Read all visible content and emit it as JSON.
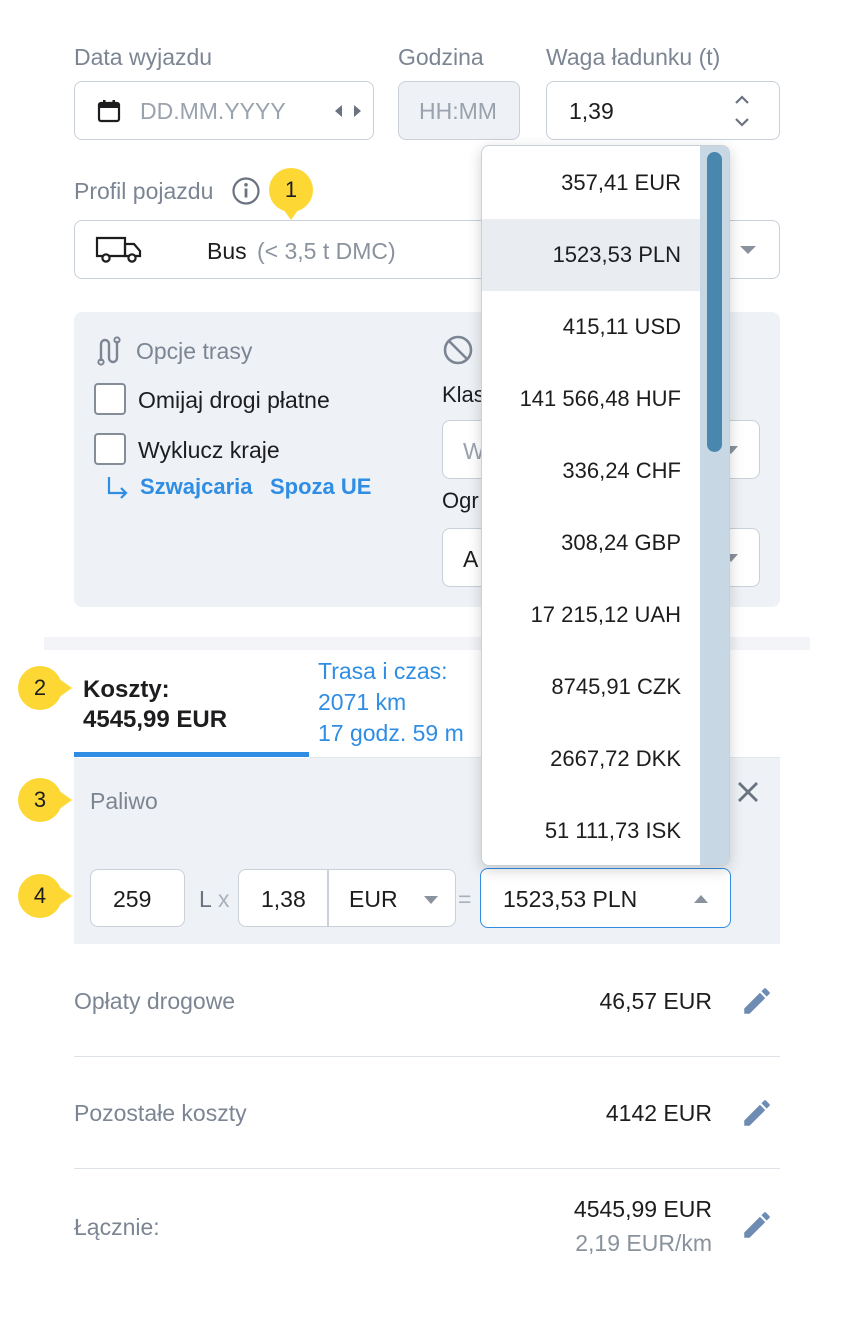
{
  "trip": {
    "date_label": "Data wyjazdu",
    "date_placeholder": "DD.MM.YYYY",
    "time_label": "Godzina",
    "time_placeholder": "HH:MM",
    "weight_label": "Waga ładunku (t)",
    "weight_value": "1,39"
  },
  "vehicle": {
    "label": "Profil pojazdu",
    "type": "Bus",
    "detail": "(< 3,5 t DMC)"
  },
  "route_options": {
    "title": "Opcje trasy",
    "avoid_tolls": "Omijaj drogi płatne",
    "exclude_countries": "Wyklucz kraje",
    "excluded": [
      "Szwajcaria",
      "Spoza UE"
    ],
    "class_label": "Klas",
    "class_value": "W",
    "restriction_label": "Ogr",
    "restriction_value": "A"
  },
  "tabs": {
    "costs_title": "Koszty:",
    "costs_value": "4545,99 EUR",
    "route_title": "Trasa i czas:",
    "route_distance": "2071 km",
    "route_duration": "17 godz. 59 m"
  },
  "fuel": {
    "label": "Paliwo",
    "liters": "259",
    "unit": "L",
    "times": "x",
    "price": "1,38",
    "currency": "EUR",
    "equals": "=",
    "total": "1523,53 PLN"
  },
  "currency_options": [
    "357,41 EUR",
    "1523,53 PLN",
    "415,11 USD",
    "141 566,48 HUF",
    "336,24 CHF",
    "308,24 GBP",
    "17 215,12 UAH",
    "8745,91 CZK",
    "2667,72 DKK",
    "51 111,73 ISK"
  ],
  "selected_currency_index": 1,
  "costs": [
    {
      "label": "Opłaty drogowe",
      "value": "46,57 EUR"
    },
    {
      "label": "Pozostałe koszty",
      "value": "4142 EUR"
    }
  ],
  "total": {
    "label": "Łącznie:",
    "value": "4545,99 EUR",
    "per_km": "2,19 EUR/km"
  },
  "badges": [
    "1",
    "2",
    "3",
    "4"
  ],
  "colors": {
    "accent": "#2f8de4",
    "badge": "#fdd835",
    "scroll_thumb": "#4a87ae",
    "panel_bg": "#eef2f6"
  }
}
